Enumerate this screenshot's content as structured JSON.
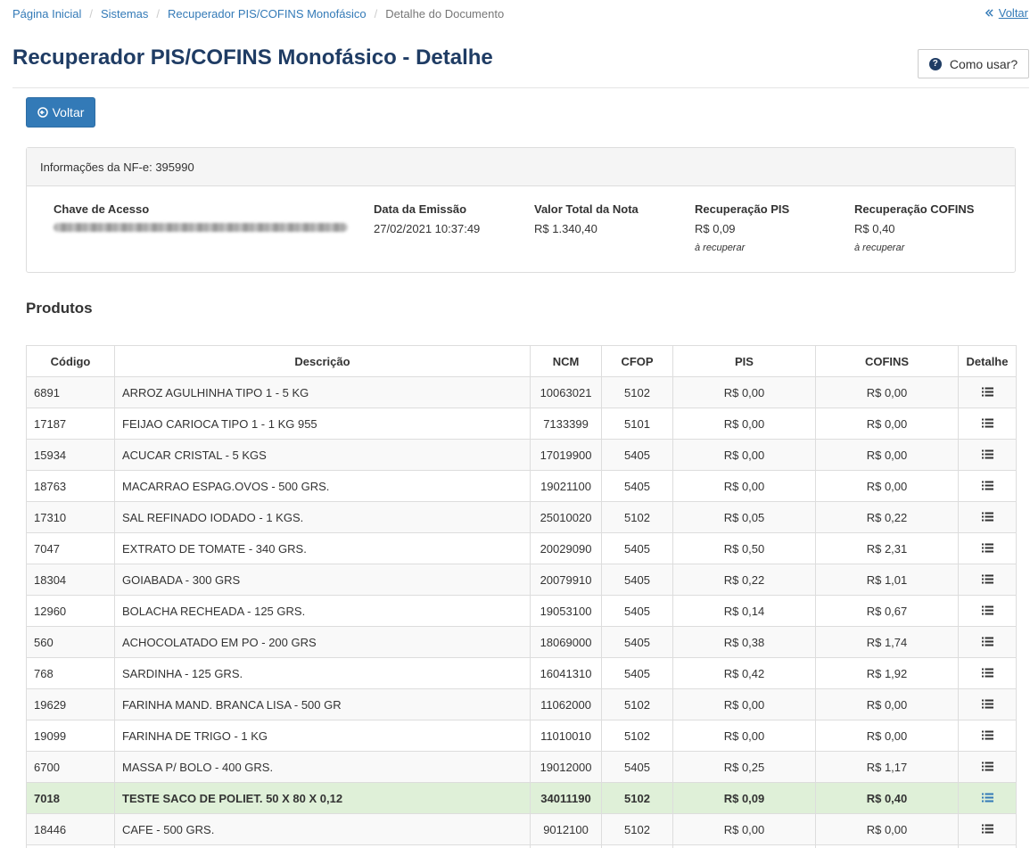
{
  "breadcrumb": {
    "items": [
      "Página Inicial",
      "Sistemas",
      "Recuperador PIS/COFINS Monofásico"
    ],
    "active": "Detalhe do Documento",
    "back": "Voltar"
  },
  "header": {
    "title": "Recuperador PIS/COFINS Monofásico - Detalhe",
    "help_label": "Como usar?",
    "help_icon": "question-circle-icon"
  },
  "back_button": {
    "label": "Voltar",
    "icon": "arrow-circle-left-icon",
    "color": "#337ab7"
  },
  "nfe": {
    "heading": "Informações da NF-e: 395990",
    "access_key_label": "Chave de Acesso",
    "emission_label": "Data da Emissão",
    "emission_value": "27/02/2021 10:37:49",
    "total_label": "Valor Total da Nota",
    "total_value": "R$ 1.340,40",
    "pis_label": "Recuperação PIS",
    "pis_value": "R$ 0,09",
    "pis_note": "à recuperar",
    "cofins_label": "Recuperação COFINS",
    "cofins_value": "R$ 0,40",
    "cofins_note": "à recuperar"
  },
  "products": {
    "title": "Produtos",
    "columns": [
      "Código",
      "Descrição",
      "NCM",
      "CFOP",
      "PIS",
      "COFINS",
      "Detalhe"
    ],
    "detail_icon": "list-icon",
    "highlight_color": "#dff0d8",
    "rows": [
      {
        "code": "6891",
        "desc": "ARROZ AGULHINHA TIPO 1 - 5 KG",
        "ncm": "10063021",
        "cfop": "5102",
        "pis": "R$ 0,00",
        "cofins": "R$ 0,00",
        "highlight": false
      },
      {
        "code": "17187",
        "desc": "FEIJAO CARIOCA TIPO 1 - 1 KG 955",
        "ncm": "7133399",
        "cfop": "5101",
        "pis": "R$ 0,00",
        "cofins": "R$ 0,00",
        "highlight": false
      },
      {
        "code": "15934",
        "desc": "ACUCAR CRISTAL - 5 KGS",
        "ncm": "17019900",
        "cfop": "5405",
        "pis": "R$ 0,00",
        "cofins": "R$ 0,00",
        "highlight": false
      },
      {
        "code": "18763",
        "desc": "MACARRAO ESPAG.OVOS - 500 GRS.",
        "ncm": "19021100",
        "cfop": "5405",
        "pis": "R$ 0,00",
        "cofins": "R$ 0,00",
        "highlight": false
      },
      {
        "code": "17310",
        "desc": "SAL REFINADO IODADO - 1 KGS.",
        "ncm": "25010020",
        "cfop": "5102",
        "pis": "R$ 0,05",
        "cofins": "R$ 0,22",
        "highlight": false
      },
      {
        "code": "7047",
        "desc": "EXTRATO DE TOMATE - 340 GRS.",
        "ncm": "20029090",
        "cfop": "5405",
        "pis": "R$ 0,50",
        "cofins": "R$ 2,31",
        "highlight": false
      },
      {
        "code": "18304",
        "desc": "GOIABADA - 300 GRS",
        "ncm": "20079910",
        "cfop": "5405",
        "pis": "R$ 0,22",
        "cofins": "R$ 1,01",
        "highlight": false
      },
      {
        "code": "12960",
        "desc": "BOLACHA RECHEADA - 125 GRS.",
        "ncm": "19053100",
        "cfop": "5405",
        "pis": "R$ 0,14",
        "cofins": "R$ 0,67",
        "highlight": false
      },
      {
        "code": "560",
        "desc": "ACHOCOLATADO EM PO - 200 GRS",
        "ncm": "18069000",
        "cfop": "5405",
        "pis": "R$ 0,38",
        "cofins": "R$ 1,74",
        "highlight": false
      },
      {
        "code": "768",
        "desc": "SARDINHA - 125 GRS.",
        "ncm": "16041310",
        "cfop": "5405",
        "pis": "R$ 0,42",
        "cofins": "R$ 1,92",
        "highlight": false
      },
      {
        "code": "19629",
        "desc": "FARINHA MAND. BRANCA LISA - 500 GR",
        "ncm": "11062000",
        "cfop": "5102",
        "pis": "R$ 0,00",
        "cofins": "R$ 0,00",
        "highlight": false
      },
      {
        "code": "19099",
        "desc": "FARINHA DE TRIGO - 1 KG",
        "ncm": "11010010",
        "cfop": "5102",
        "pis": "R$ 0,00",
        "cofins": "R$ 0,00",
        "highlight": false
      },
      {
        "code": "6700",
        "desc": "MASSA P/ BOLO - 400 GRS.",
        "ncm": "19012000",
        "cfop": "5405",
        "pis": "R$ 0,25",
        "cofins": "R$ 1,17",
        "highlight": false
      },
      {
        "code": "7018",
        "desc": "TESTE SACO DE POLIET. 50 X 80 X 0,12",
        "ncm": "34011190",
        "cfop": "5102",
        "pis": "R$ 0,09",
        "cofins": "R$ 0,40",
        "highlight": true
      },
      {
        "code": "18446",
        "desc": "CAFE - 500 GRS.",
        "ncm": "9012100",
        "cfop": "5102",
        "pis": "R$ 0,00",
        "cofins": "R$ 0,00",
        "highlight": false
      },
      {
        "code": "",
        "desc": "",
        "ncm": "",
        "cfop": "",
        "pis": "",
        "cofins": "",
        "highlight": false
      }
    ]
  }
}
